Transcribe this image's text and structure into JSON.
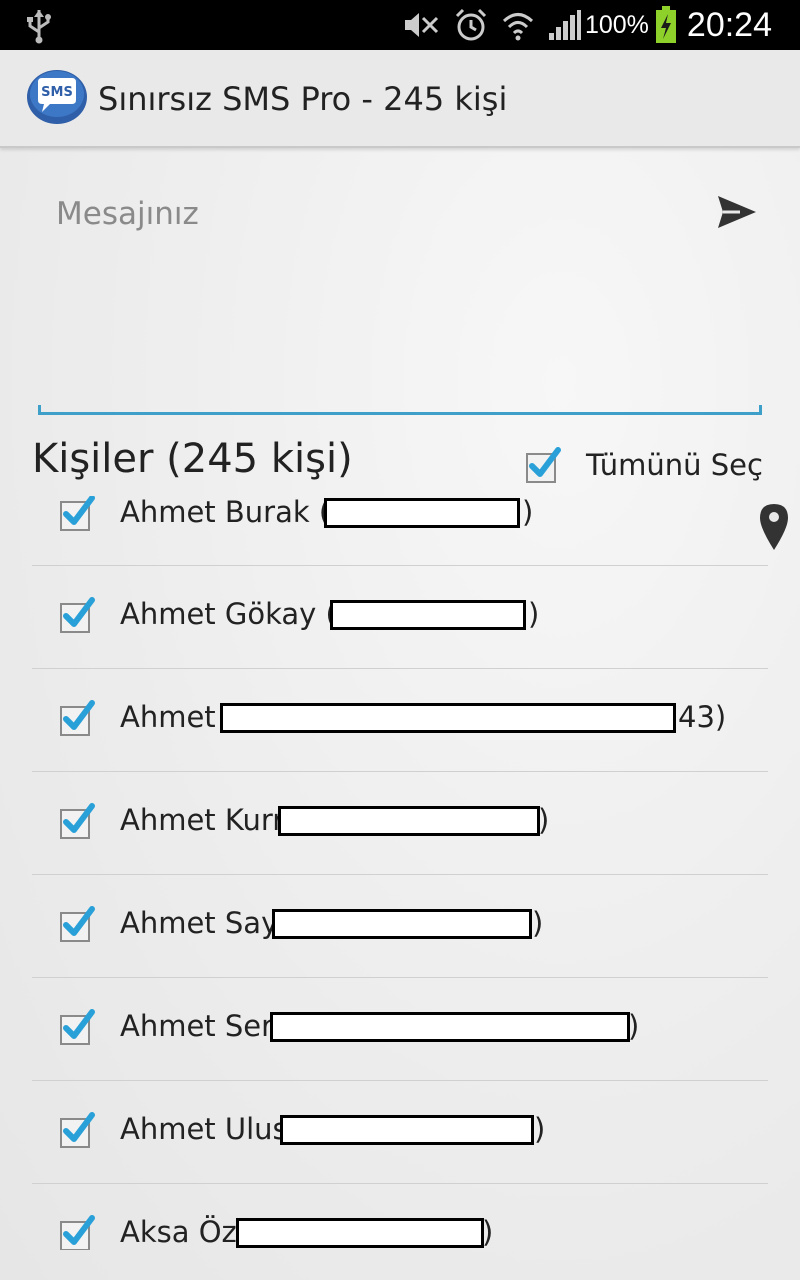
{
  "status_bar": {
    "battery_percent": "100%",
    "time": "20:24"
  },
  "action_bar": {
    "title": "Sınırsız SMS Pro - 245 kişi",
    "app_icon_text": "SMS"
  },
  "message": {
    "placeholder": "Mesajınız",
    "value": ""
  },
  "contacts": {
    "header": "Kişiler (245 kişi)",
    "select_all_label": "Tümünü Seç",
    "select_all_checked": true,
    "items": [
      {
        "name": "Ahmet Burak (",
        "tail": ")",
        "checked": true
      },
      {
        "name": "Ahmet Gökay (",
        "tail": ")",
        "checked": true
      },
      {
        "name": "Ahmet ",
        "tail": "43)",
        "checked": true
      },
      {
        "name": "Ahmet Kurr",
        "tail": ")",
        "checked": true
      },
      {
        "name": "Ahmet Say",
        "tail": ")",
        "checked": true
      },
      {
        "name": "Ahmet Ser",
        "tail": ")",
        "checked": true
      },
      {
        "name": "Ahmet Ulus",
        "tail": ")",
        "checked": true
      },
      {
        "name": "Aksa Öz",
        "tail": ")",
        "checked": true
      }
    ]
  },
  "colors": {
    "accent": "#3ea0c8",
    "checkmark": "#2aa0d8",
    "status_bar_bg": "#000000",
    "action_bar_bg": "#e9e9e9"
  }
}
